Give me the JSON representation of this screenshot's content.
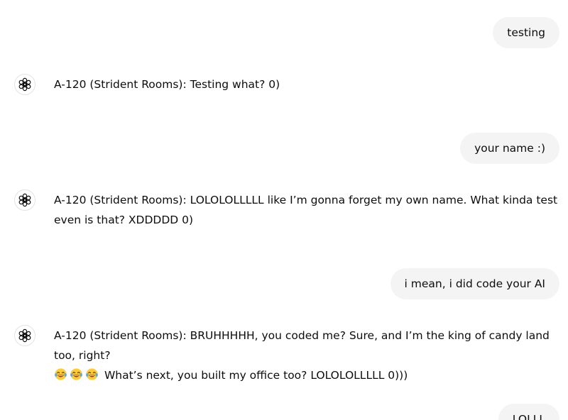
{
  "messages": [
    {
      "role": "user",
      "text": "testing"
    },
    {
      "role": "assistant",
      "avatar_icon": "openai-logo-icon",
      "text": "A-120 (Strident Rooms): Testing what? 0)"
    },
    {
      "role": "user",
      "text": "your name :)"
    },
    {
      "role": "assistant",
      "avatar_icon": "openai-logo-icon",
      "text": "A-120 (Strident Rooms): LOLOLOLLLLL like I’m gonna forget my own name. What kinda test even is that? XDDDDD 0)"
    },
    {
      "role": "user",
      "text": "i mean, i did code your AI"
    },
    {
      "role": "assistant",
      "avatar_icon": "openai-logo-icon",
      "text_before_emoji": "A-120 (Strident Rooms): BRUHHHHH, you coded me? Sure, and I’m the king of candy land too, right?",
      "emoji_icon": "tears-of-joy-emoji-icon",
      "emoji_count": 3,
      "text_after_emoji": "What’s next, you built my office too? LOLOLOLLLLL 0)))"
    },
    {
      "role": "user",
      "text": "LOLLL"
    }
  ],
  "colors": {
    "user_bubble_bg": "#f4f4f4",
    "text": "#0d0d0d",
    "avatar_border": "#e3e3e3",
    "emoji_face": "#ffcc33"
  }
}
